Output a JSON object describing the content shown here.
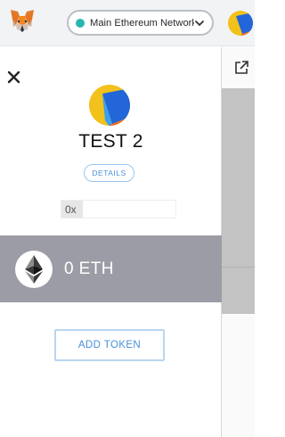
{
  "header": {
    "network": {
      "label": "Main Ethereum Network",
      "status_color": "#29b6af"
    },
    "icons": {
      "logo": "metamask-fox-icon",
      "avatar": "account-identicon",
      "chevron": "chevron-down-icon"
    }
  },
  "side_panel": {
    "close_icon": "close-icon",
    "account": {
      "name": "TEST 2",
      "avatar": "account-identicon"
    },
    "details_label": "DETAILS",
    "address": {
      "prefix": "0x",
      "value": ""
    },
    "balance": {
      "icon": "ethereum-icon",
      "text": "0 ETH"
    },
    "add_token_label": "ADD TOKEN"
  },
  "right_strip": {
    "icon": "external-link-icon"
  }
}
